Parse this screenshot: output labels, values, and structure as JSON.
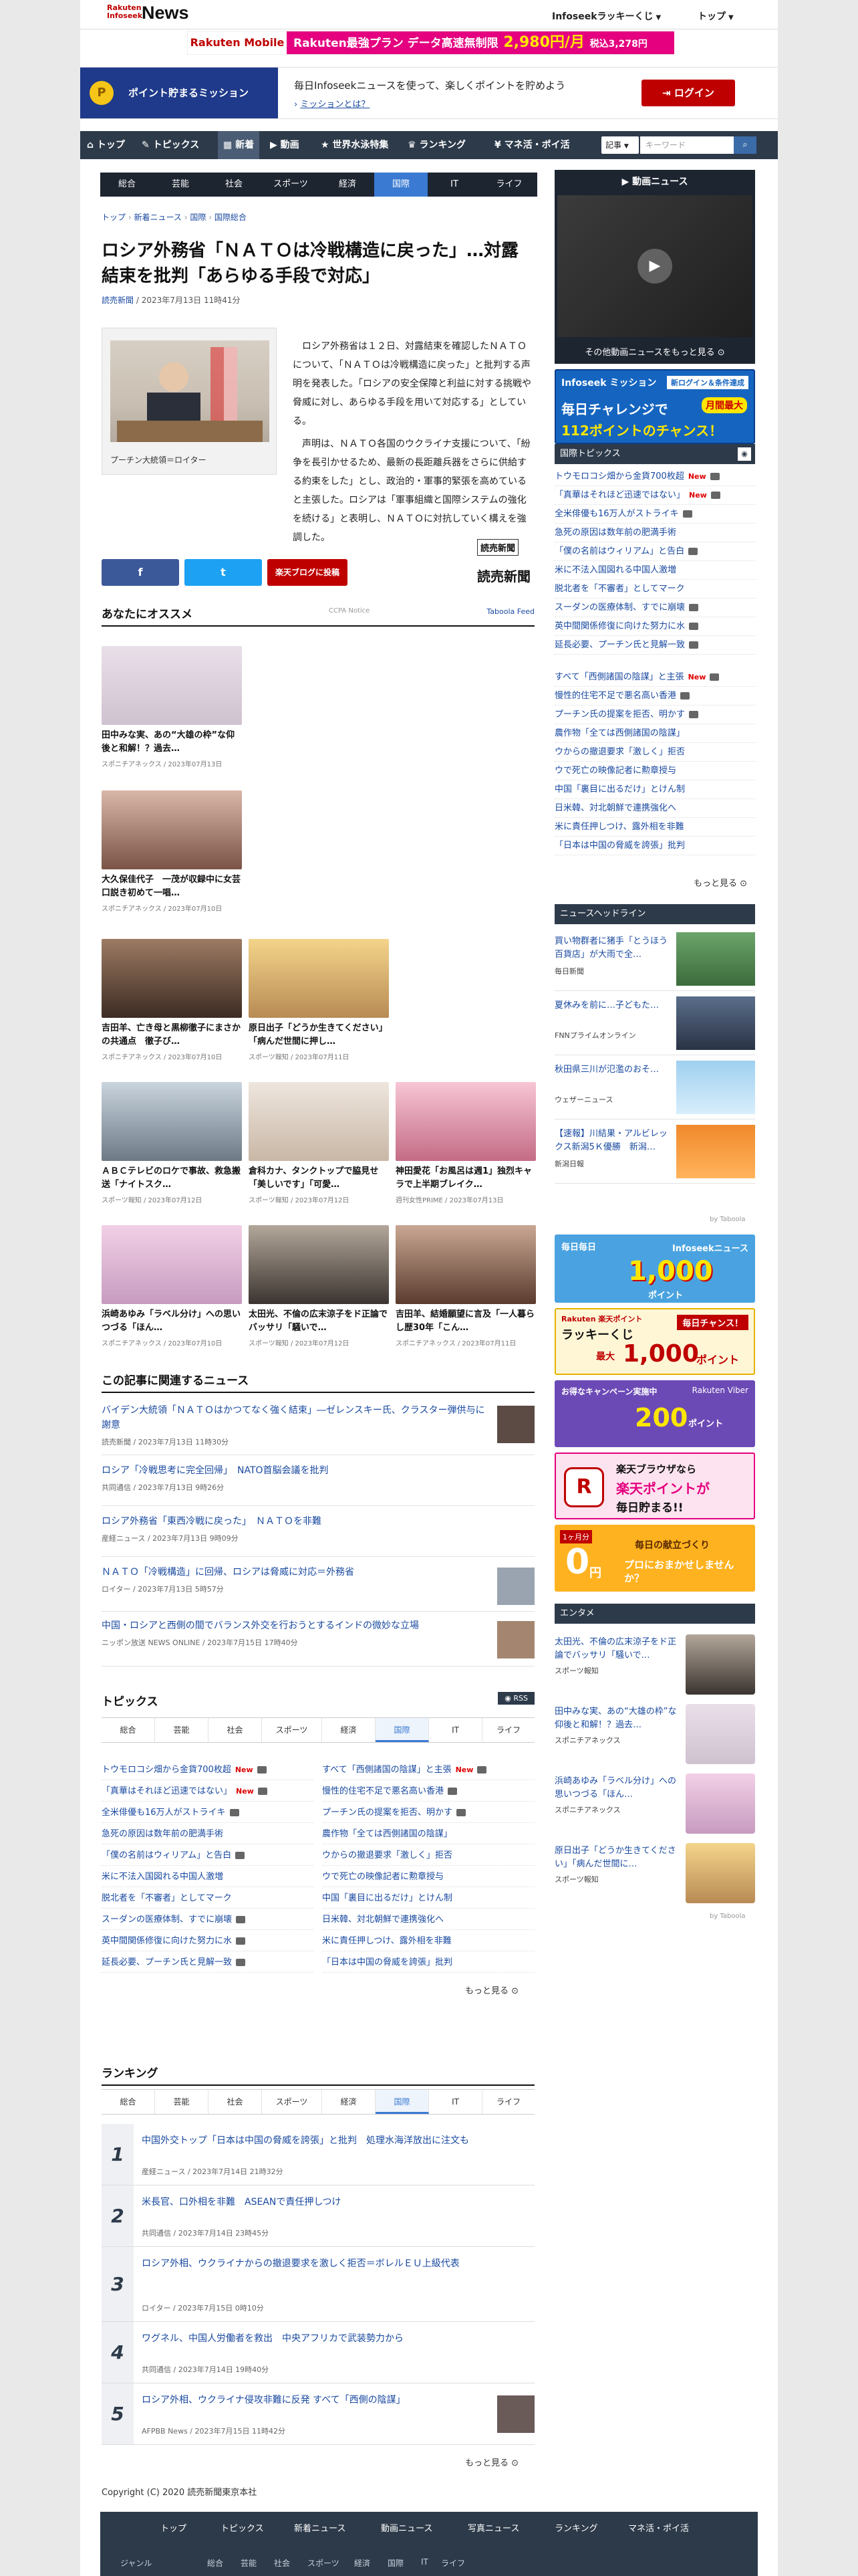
{
  "header": {
    "logo_brand": "Rakuten Infoseek",
    "logo_news": "News",
    "lucky": "Infoseekラッキーくじ",
    "top": "トップ"
  },
  "ad_top": {
    "brand": "Rakuten Mobile",
    "headline": "Rakuten最強プラン データ高速無制限",
    "price": "2,980円/月",
    "sub": "税込3,278円"
  },
  "mission": {
    "badge": "ポイント貯まるミッション",
    "message": "毎日Infoseekニュースを使って、楽しくポイントを貯めよう",
    "link": "ミッションとは？",
    "login": "ログイン"
  },
  "gnav": {
    "items": [
      "トップ",
      "トピックス",
      "新着",
      "動画",
      "世界水泳特集",
      "ランキング",
      "マネ活・ポイ活"
    ],
    "select": "記事",
    "placeholder": "キーワード"
  },
  "cnav": [
    "総合",
    "芸能",
    "社会",
    "スポーツ",
    "経済",
    "国際",
    "IT",
    "ライフ"
  ],
  "breadcrumb": [
    "トップ",
    "新着ニュース",
    "国際",
    "国際総合"
  ],
  "article": {
    "title": "ロシア外務省「ＮＡＴＯは冷戦構造に戻った」…対露結束を批判「あらゆる手段で対応」",
    "source": "読売新聞",
    "date": "2023年7月13日 11時41分",
    "caption": "プーチン大統領＝ロイター",
    "p1": "ロシア外務省は１２日、対露結束を確認したＮＡＴＯについて、「ＮＡＴＯは冷戦構造に戻った」と批判する声明を発表した。「ロシアの安全保障と利益に対する挑戦や脅威に対し、あらゆる手段を用いて対応する」としている。",
    "p2": "声明は、ＮＡＴＯ各国のウクライナ支援について、「紛争を長引かせるため、最新の長距離兵器をさらに供給する約束をした」とし、政治的・軍事的緊張を高めていると主張した。ロシアは「軍事組織と国際システムの強化を続ける」と表明し、ＮＡＴＯに対抗していく構えを強調した。",
    "publisher_logo": "読売新聞",
    "share": {
      "facebook": "f",
      "twitter": "t",
      "blog": "楽天ブログに投稿"
    }
  },
  "recommend": {
    "title": "あなたにオススメ",
    "notice": "CCPA Notice",
    "feed": "Taboola Feed",
    "items": [
      {
        "t": "田中みな実、あの“大雄の枠”な仰後と和解！？過去…",
        "s": "スポニチアネックス / 2023年07月13日"
      },
      {
        "t": "大久保佳代子　一茂が収録中に女芸口説き初めて一唱…",
        "s": "スポニチアネックス / 2023年07月10日"
      },
      {
        "t": "吉田羊、亡き母と黒柳徹子にまさかの共通点　徹子び…",
        "s": "スポニチアネックス / 2023年07月10日"
      },
      {
        "t": "原日出子「どうか生きてください」「病んだ世間に押し…",
        "s": "スポーツ報知 / 2023年07月11日"
      },
      {
        "t": "ＡＢＣテレビのロケで事故、救急搬送「ナイトスク…",
        "s": "スポーツ報知 / 2023年07月12日"
      },
      {
        "t": "倉科カナ、タンクトップで脇見せ「美しいです」「可愛…",
        "s": "スポーツ報知 / 2023年07月12日"
      },
      {
        "t": "神田愛花「お風呂は週1」独烈キャラで上半期ブレイク…",
        "s": "週刊女性PRIME / 2023年07月13日"
      },
      {
        "t": "浜崎あゆみ「ラベル分け」への思いつづる「ほん…",
        "s": "スポニチアネックス / 2023年07月10日"
      },
      {
        "t": "太田光、不倫の広末涼子をド正論でバッサリ「騒いで…",
        "s": "スポーツ報知 / 2023年07月12日"
      },
      {
        "t": "吉田羊、結婚願望に言及「一人暮らし歴30年「こん…",
        "s": "スポニチアネックス / 2023年07月11日"
      }
    ]
  },
  "related": {
    "title": "この記事に関連するニュース",
    "items": [
      {
        "t": "バイデン大統領「ＮＡＴＯはかつてなく強く結束」―ゼレンスキー氏、クラスター弾供与に謝意",
        "s": "読売新聞 / 2023年7月13日 11時30分"
      },
      {
        "t": "ロシア「冷戦思考に完全回帰」　NATO首脳会議を批判",
        "s": "共同通信 / 2023年7月13日 9時26分"
      },
      {
        "t": "ロシア外務省「東西冷戦に戻った」　ＮＡＴＯを非難",
        "s": "産経ニュース / 2023年7月13日 9時09分"
      },
      {
        "t": "ＮＡＴＯ「冷戦構造」に回帰、ロシアは脅威に対応＝外務省",
        "s": "ロイター / 2023年7月13日 5時57分"
      },
      {
        "t": "中国・ロシアと西側の間でバランス外交を行おうとするインドの微妙な立場",
        "s": "ニッポン放送 NEWS ONLINE / 2023年7月15日 17時40分"
      }
    ]
  },
  "topics": {
    "title": "トピックス",
    "rss": "RSS",
    "left": [
      "トウモロコシ畑から金貨700枚超",
      "「真華はそれほど迅速ではない」",
      "全米俳優も16万人がストライキ",
      "急死の原因は数年前の肥満手術",
      "「僕の名前はウィリアム」と告白",
      "米に不法入国図れる中国人激増",
      "脱北者を「不審者」としてマーク",
      "スーダンの医療体制、すでに崩壊",
      "英中間関係修復に向けた努力に水",
      "延長必要、プーチン氏と見解一致"
    ],
    "right": [
      "すべて「西側諸国の陰謀」と主張",
      "慢性的住宅不足で悪名高い香港",
      "プーチン氏の提案を拒否、明かす",
      "農作物「全ては西側諸国の陰謀」",
      "ウからの撤退要求「激しく」拒否",
      "ウで死亡の映像記者に勲章授与",
      "中国「裏目に出るだけ」とけん制",
      "日米韓、対北朝鮮で連携強化へ",
      "米に責任押しつけ、露外相を非難",
      "「日本は中国の脅威を誇張」批判"
    ],
    "more": "もっと見る"
  },
  "ranking": {
    "title": "ランキング",
    "items": [
      {
        "n": "1",
        "t": "中国外交トップ「日本は中国の脅威を誇張」と批判　処理水海洋放出に注文も",
        "s": "産経ニュース / 2023年7月14日 21時32分"
      },
      {
        "n": "2",
        "t": "米長官、口外相を非難　ASEANで責任押しつけ",
        "s": "共同通信 / 2023年7月14日 23時45分"
      },
      {
        "n": "3",
        "t": "ロシア外相、ウクライナからの撤退要求を激しく拒否＝ボレルＥＵ上級代表",
        "s": "ロイター / 2023年7月15日 0時10分"
      },
      {
        "n": "4",
        "t": "ワグネル、中国人労働者を救出　中央アフリカで武装勢力から",
        "s": "共同通信 / 2023年7月14日 19時40分"
      },
      {
        "n": "5",
        "t": "ロシア外相、ウクライナ侵攻非難に反発 すべて「西側の陰謀」",
        "s": "AFPBB News / 2023年7月15日 11時42分"
      }
    ],
    "more": "もっと見る"
  },
  "footer": {
    "copyright": "Copyright (C) 2020 読売新聞東京本社",
    "nav": [
      "トップ",
      "トピックス",
      "新着ニュース",
      "動画ニュース",
      "写真ニュース",
      "ランキング",
      "マネ活・ポイ活"
    ],
    "genre_label": "ジャンル",
    "genres": [
      "総合",
      "芸能",
      "社会",
      "スポーツ",
      "経済",
      "国際",
      "IT",
      "ライフ"
    ]
  },
  "sidebar": {
    "video_title": "動画ニュース",
    "video_more": "その他動画ニュースをもっと見る",
    "mission_banner": {
      "a": "Infoseek ミッション",
      "b": "新ログイン＆条件達成",
      "c": "毎日チャレンジで",
      "d": "月間最大",
      "e": "112ポイントのチャンス！"
    },
    "intl_topics_title": "国際トピックス",
    "intl": [
      "トウモロコシ畑から金貨700枚超",
      "「真華はそれほど迅速ではない」",
      "全米俳優も16万人がストライキ",
      "急死の原因は数年前の肥満手術",
      "「僕の名前はウィリアム」と告白",
      "米に不法入国図れる中国人激増",
      "脱北者を「不審者」としてマーク",
      "スーダンの医療体制、すでに崩壊",
      "英中間関係修復に向けた努力に水",
      "延長必要、プーチン氏と見解一致",
      "すべて「西側諸国の陰謀」と主張",
      "慢性的住宅不足で悪名高い香港",
      "プーチン氏の提案を拒否、明かす",
      "農作物「全ては西側諸国の陰謀」",
      "ウからの撤退要求「激しく」拒否",
      "ウで死亡の映像記者に勲章授与",
      "中国「裏目に出るだけ」とけん制",
      "日米韓、対北朝鮮で連携強化へ",
      "米に責任押しつけ、露外相を非難",
      "「日本は中国の脅威を誇張」批判"
    ],
    "intl_more": "もっと見る",
    "headline_title": "ニュースヘッドライン",
    "headlines": [
      {
        "t": "買い物群者に猪手「とうほう百貨店」が大雨で全…",
        "s": "毎日新聞"
      },
      {
        "t": "夏休みを前に…子どもた…",
        "s": "FNNプライムオンライン"
      },
      {
        "t": "秋田県三川が氾濫のおそ…",
        "s": "ウェザーニュース"
      },
      {
        "t": "【速報】川結果・アルビレックス新潟5Ｋ優勝　新潟…",
        "s": "新潟日報"
      }
    ],
    "by_taboola": "by Taboola",
    "lucky_banner": {
      "a": "毎日毎日",
      "b": "Infoseekニュース",
      "c": "1,000",
      "d": "ポイント"
    },
    "kuji_banner": {
      "a": "Rakuten 楽天ポイント",
      "b": "ラッキーくじ",
      "c": "毎日チャンス！",
      "d": "最大",
      "e": "1,000",
      "f": "ポイント"
    },
    "viber_banner": {
      "a": "お得なキャンペーン実施中",
      "b": "Rakuten Viber",
      "c": "200",
      "d": "ポイント"
    },
    "browser_banner": {
      "a": "楽天ブラウザなら",
      "b": "楽天ポイントが",
      "c": "毎日貯まる!!"
    },
    "zero_banner": {
      "a": "1ヶ月分",
      "b": "0",
      "c": "円",
      "d": "毎日の献立づくり",
      "e": "プロにおまかせしませんか？"
    },
    "ent_title": "エンタメ",
    "ent": [
      {
        "t": "太田光、不倫の広末涼子をド正論でバッサリ「騒いで…",
        "s": "スポーツ報知"
      },
      {
        "t": "田中みな実、あの“大雄の枠”な仰後と和解！？過去…",
        "s": "スポニチアネックス"
      },
      {
        "t": "浜崎あゆみ「ラベル分け」への思いつづる「ほん…",
        "s": "スポニチアネックス"
      },
      {
        "t": "原日出子「どうか生きてください」「病んだ世間に…",
        "s": "スポーツ報知"
      }
    ]
  },
  "colors": {
    "brand": "#bf0000",
    "navy": "#2d3a4a",
    "accent": "#3a7ad3",
    "link": "#1a4aa0"
  },
  "icons": [
    "home-icon",
    "search-icon",
    "video-icon",
    "camera-icon",
    "rss-icon",
    "chevron-right-icon",
    "play-icon"
  ]
}
